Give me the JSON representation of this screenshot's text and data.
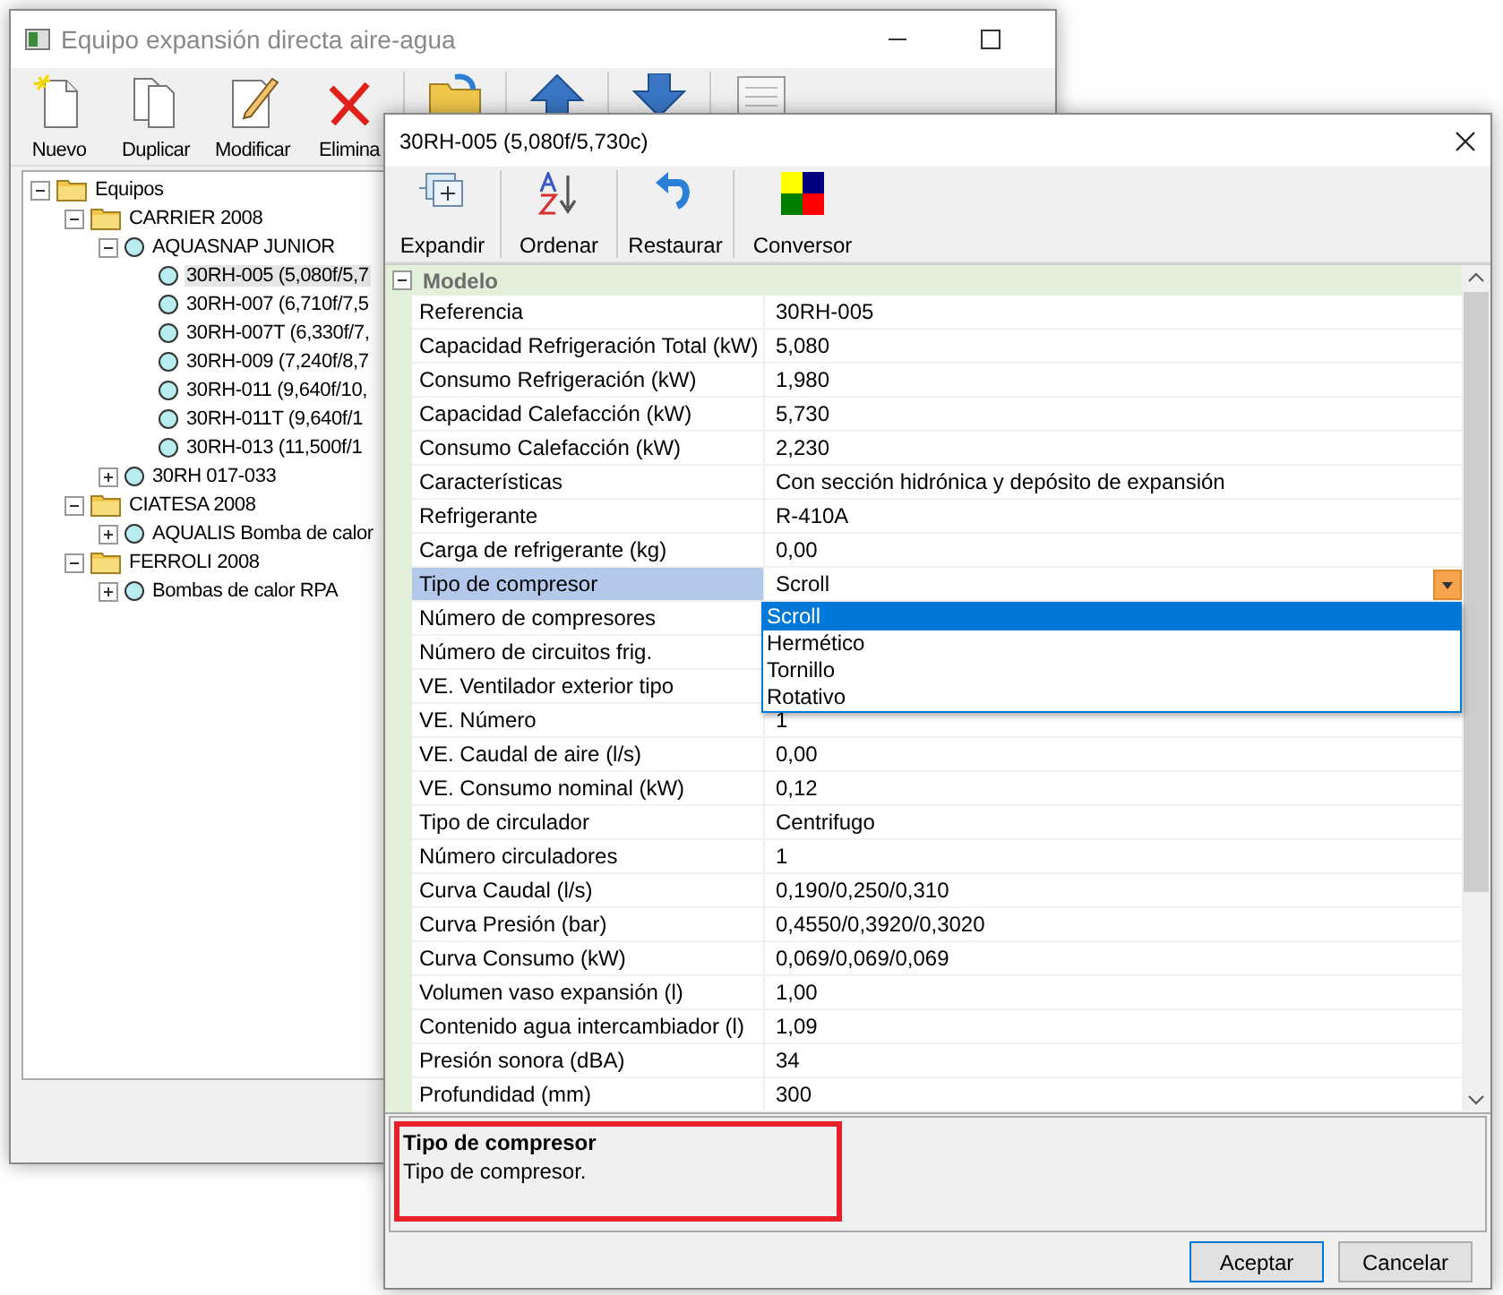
{
  "main_window": {
    "title": "Equipo expansión directa aire-agua",
    "toolbar": [
      {
        "label": "Nuevo"
      },
      {
        "label": "Duplicar"
      },
      {
        "label": "Modificar"
      },
      {
        "label": "Elimina"
      }
    ],
    "tree": [
      {
        "label": "Equipos",
        "kind": "folder",
        "expanded": true,
        "selected": false,
        "children": [
          {
            "label": "CARRIER 2008",
            "kind": "folder",
            "expanded": true,
            "selected": false,
            "children": [
              {
                "label": "AQUASNAP JUNIOR",
                "kind": "model",
                "expanded": true,
                "selected": false,
                "children": [
                  {
                    "label": "30RH-005 (5,080f/5,7",
                    "kind": "model",
                    "selected": true
                  },
                  {
                    "label": "30RH-007 (6,710f/7,5",
                    "kind": "model",
                    "selected": false
                  },
                  {
                    "label": "30RH-007T (6,330f/7,",
                    "kind": "model",
                    "selected": false
                  },
                  {
                    "label": "30RH-009 (7,240f/8,7",
                    "kind": "model",
                    "selected": false
                  },
                  {
                    "label": "30RH-011 (9,640f/10,",
                    "kind": "model",
                    "selected": false
                  },
                  {
                    "label": "30RH-011T (9,640f/1",
                    "kind": "model",
                    "selected": false
                  },
                  {
                    "label": "30RH-013 (11,500f/1",
                    "kind": "model",
                    "selected": false
                  }
                ]
              },
              {
                "label": "30RH 017-033",
                "kind": "model",
                "expanded": false,
                "selected": false
              }
            ]
          },
          {
            "label": "CIATESA 2008",
            "kind": "folder",
            "expanded": true,
            "selected": false,
            "children": [
              {
                "label": "AQUALIS Bomba de calor",
                "kind": "model",
                "expanded": false,
                "selected": false
              }
            ]
          },
          {
            "label": "FERROLI 2008",
            "kind": "folder",
            "expanded": true,
            "selected": false,
            "children": [
              {
                "label": "Bombas de calor RPA",
                "kind": "model",
                "expanded": false,
                "selected": false
              }
            ]
          }
        ]
      }
    ]
  },
  "dialog": {
    "title": "30RH-005 (5,080f/5,730c)",
    "toolbar": [
      {
        "label": "Expandir"
      },
      {
        "label": "Ordenar"
      },
      {
        "label": "Restaurar"
      },
      {
        "label": "Conversor"
      }
    ],
    "category": {
      "label": "Modelo",
      "expanded": true
    },
    "rows": [
      {
        "label": "Referencia",
        "value": "30RH-005",
        "selected": false
      },
      {
        "label": "Capacidad Refrigeración Total (kW)",
        "value": "5,080",
        "selected": false
      },
      {
        "label": "Consumo Refrigeración (kW)",
        "value": "1,980",
        "selected": false
      },
      {
        "label": "Capacidad Calefacción (kW)",
        "value": "5,730",
        "selected": false
      },
      {
        "label": "Consumo Calefacción (kW)",
        "value": "2,230",
        "selected": false
      },
      {
        "label": "Características",
        "value": "Con sección hidrónica y depósito de expansión",
        "selected": false
      },
      {
        "label": "Refrigerante",
        "value": "R-410A",
        "selected": false
      },
      {
        "label": "Carga de refrigerante (kg)",
        "value": "0,00",
        "selected": false
      },
      {
        "label": "Tipo de compresor",
        "value": "Scroll",
        "selected": true,
        "kind": "dropdown",
        "open": true,
        "options": [
          {
            "label": "Scroll",
            "selected": true
          },
          {
            "label": "Hermético",
            "selected": false
          },
          {
            "label": "Tornillo",
            "selected": false
          },
          {
            "label": "Rotativo",
            "selected": false
          }
        ]
      },
      {
        "label": "Número de compresores",
        "selected": false
      },
      {
        "label": "Número de circuitos frig.",
        "selected": false
      },
      {
        "label": "VE. Ventilador exterior tipo",
        "selected": false
      },
      {
        "label": "VE. Número",
        "value": "1",
        "selected": false
      },
      {
        "label": "VE. Caudal de aire (l/s)",
        "value": "0,00",
        "selected": false
      },
      {
        "label": "VE. Consumo nominal (kW)",
        "value": "0,12",
        "selected": false
      },
      {
        "label": "Tipo de circulador",
        "value": "Centrifugo",
        "selected": false
      },
      {
        "label": "Número circuladores",
        "value": "1",
        "selected": false
      },
      {
        "label": "Curva Caudal (l/s)",
        "value": "0,190/0,250/0,310",
        "selected": false
      },
      {
        "label": "Curva Presión (bar)",
        "value": "0,4550/0,3920/0,3020",
        "selected": false
      },
      {
        "label": "Curva Consumo (kW)",
        "value": "0,069/0,069/0,069",
        "selected": false
      },
      {
        "label": "Volumen vaso expansión (l)",
        "value": "1,00",
        "selected": false
      },
      {
        "label": "Contenido agua intercambiador (l)",
        "value": "1,09",
        "selected": false
      },
      {
        "label": "Presión sonora (dBA)",
        "value": "34",
        "selected": false
      },
      {
        "label": "Profundidad (mm)",
        "value": "300",
        "selected": false
      }
    ],
    "description": {
      "title": "Tipo de compresor",
      "text": "Tipo de compresor.",
      "highlighted": true
    },
    "buttons": [
      {
        "label": "Aceptar",
        "default": true
      },
      {
        "label": "Cancelar",
        "default": false
      }
    ]
  }
}
